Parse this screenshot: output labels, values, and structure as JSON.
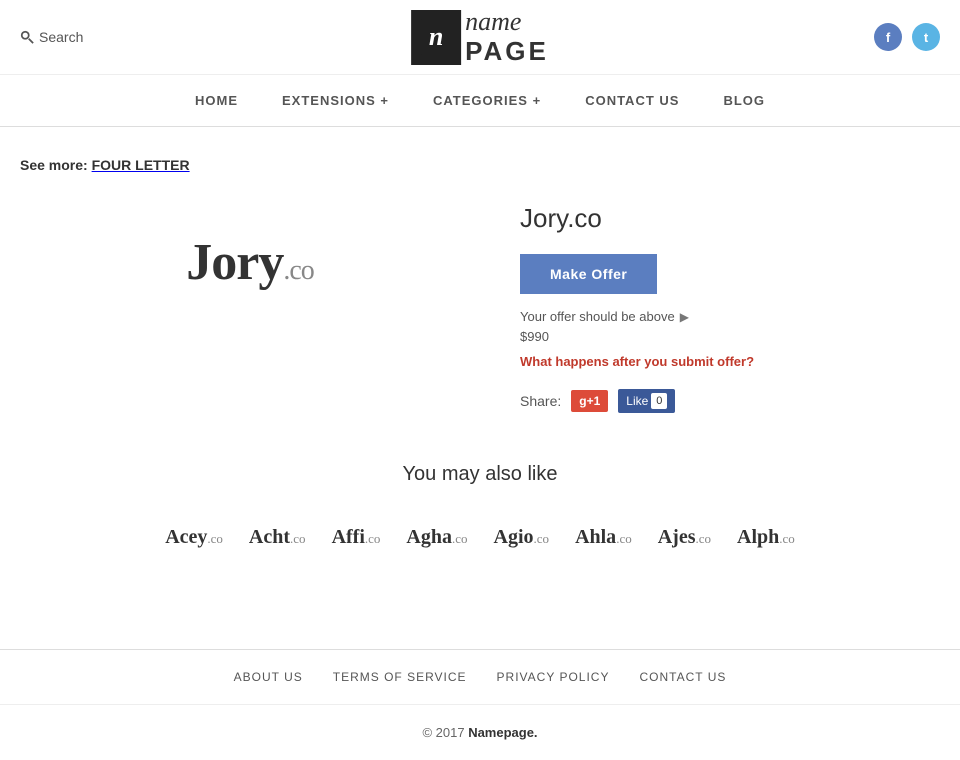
{
  "header": {
    "search_label": "Search",
    "logo_icon_letter": "n",
    "logo_name": "name",
    "logo_page": "PAGE",
    "facebook_aria": "Facebook",
    "twitter_aria": "Twitter"
  },
  "nav": {
    "items": [
      {
        "label": "HOME",
        "href": "#"
      },
      {
        "label": "EXTENSIONS +",
        "href": "#"
      },
      {
        "label": "CATEGORIES +",
        "href": "#"
      },
      {
        "label": "CONTACT US",
        "href": "#"
      },
      {
        "label": "BLOG",
        "href": "#"
      }
    ]
  },
  "see_more": {
    "prefix": "See more:",
    "link": "FOUR LETTER"
  },
  "domain": {
    "name": "Jory",
    "ext": ".co",
    "full": "Jory.co",
    "make_offer_label": "Make Offer",
    "offer_hint": "Your offer should be above",
    "offer_price": "$990",
    "what_happens_link": "What happens after you submit offer?",
    "share_label": "Share:",
    "gplus_label": "g+1",
    "fb_like_label": "Like",
    "fb_count": "0"
  },
  "also_like": {
    "title": "You may also like",
    "domains": [
      {
        "name": "Acey",
        "ext": ".co"
      },
      {
        "name": "Acht",
        "ext": ".co"
      },
      {
        "name": "Affi",
        "ext": ".co"
      },
      {
        "name": "Agha",
        "ext": ".co"
      },
      {
        "name": "Agio",
        "ext": ".co"
      },
      {
        "name": "Ahla",
        "ext": ".co"
      },
      {
        "name": "Ajes",
        "ext": ".co"
      },
      {
        "name": "Alph",
        "ext": ".co"
      }
    ]
  },
  "footer": {
    "nav_items": [
      {
        "label": "ABOUT US",
        "href": "#"
      },
      {
        "label": "TERMS OF SERVICE",
        "href": "#"
      },
      {
        "label": "PRIVACY POLICY",
        "href": "#"
      },
      {
        "label": "CONTACT US",
        "href": "#"
      }
    ],
    "copyright": "© 2017",
    "brand": "Namepage.",
    "brand_href": "#"
  }
}
